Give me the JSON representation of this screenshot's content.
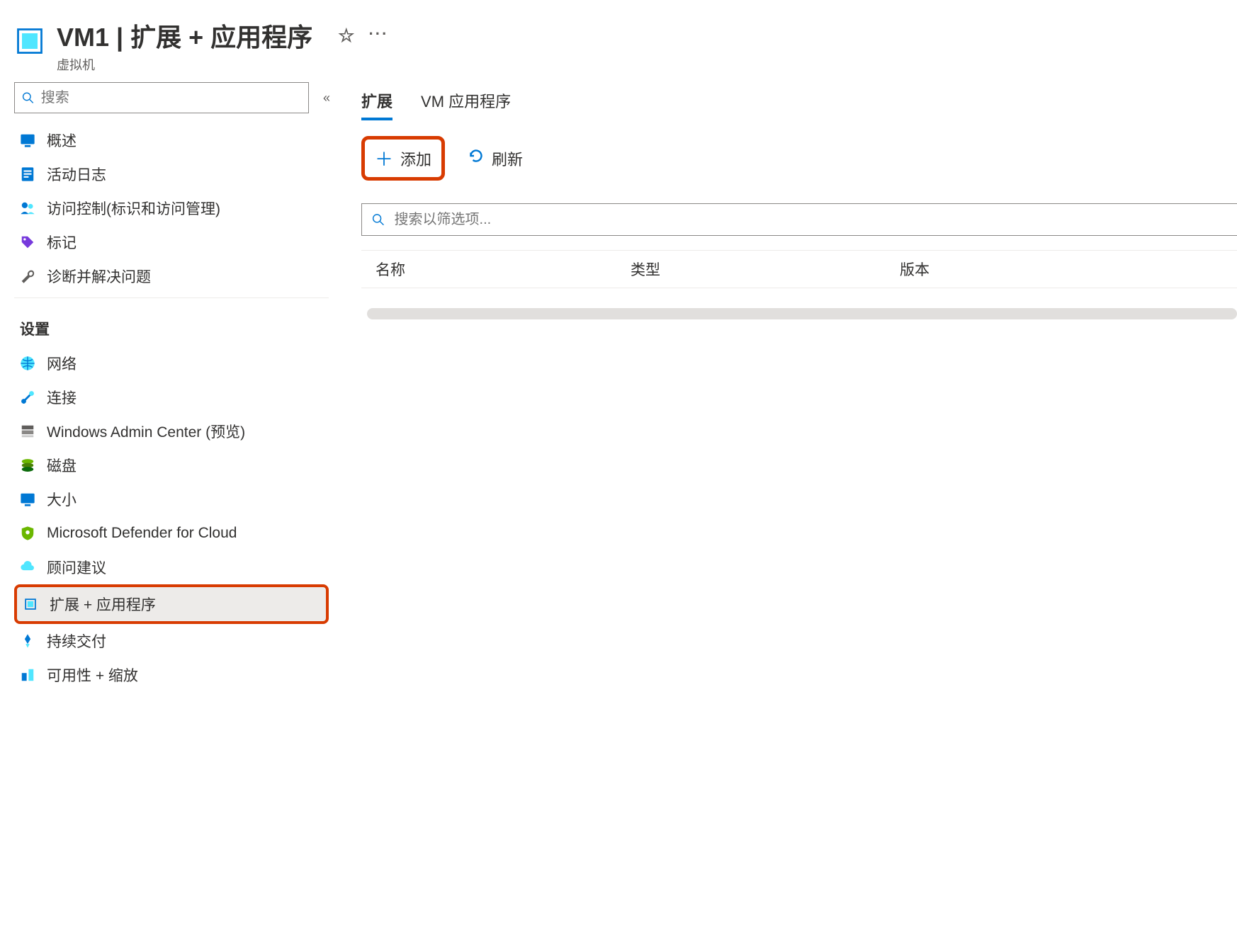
{
  "header": {
    "title": "VM1 | 扩展 + 应用程序",
    "subtitle": "虚拟机"
  },
  "sidebar": {
    "search_placeholder": "搜索",
    "section_settings": "设置",
    "items_top": [
      {
        "key": "overview",
        "label": "概述"
      },
      {
        "key": "activity-log",
        "label": "活动日志"
      },
      {
        "key": "access-control",
        "label": "访问控制(标识和访问管理)"
      },
      {
        "key": "tags",
        "label": "标记"
      },
      {
        "key": "diagnose",
        "label": "诊断并解决问题"
      }
    ],
    "items_settings": [
      {
        "key": "networking",
        "label": "网络"
      },
      {
        "key": "connect",
        "label": "连接"
      },
      {
        "key": "wac",
        "label": "Windows Admin Center (预览)"
      },
      {
        "key": "disks",
        "label": "磁盘"
      },
      {
        "key": "size",
        "label": "大小"
      },
      {
        "key": "defender",
        "label": "Microsoft Defender for Cloud"
      },
      {
        "key": "advisor",
        "label": "顾问建议"
      },
      {
        "key": "extensions",
        "label": "扩展 + 应用程序"
      },
      {
        "key": "cd",
        "label": "持续交付"
      },
      {
        "key": "availability",
        "label": "可用性 + 缩放"
      }
    ]
  },
  "main": {
    "tabs": [
      {
        "key": "extensions",
        "label": "扩展",
        "active": true
      },
      {
        "key": "vmapps",
        "label": "VM 应用程序",
        "active": false
      }
    ],
    "toolbar": {
      "add_label": "添加",
      "refresh_label": "刷新"
    },
    "filter_placeholder": "搜索以筛选项...",
    "columns": {
      "name": "名称",
      "type": "类型",
      "version": "版本"
    }
  }
}
